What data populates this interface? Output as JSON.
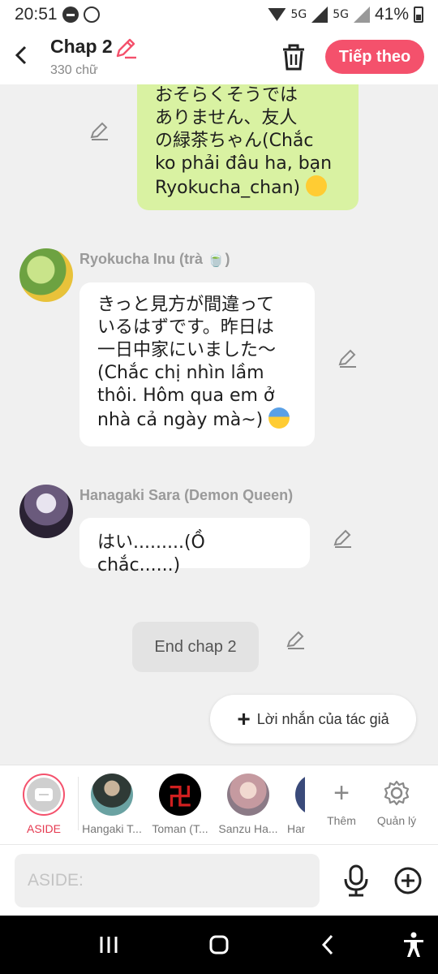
{
  "status_bar": {
    "time": "20:51",
    "network1": "5G",
    "network2": "5G",
    "battery": "41%"
  },
  "header": {
    "title": "Chap 2",
    "subtitle": "330 chữ",
    "next_label": "Tiếp theo"
  },
  "messages": [
    {
      "type": "self",
      "text": "おそらくそうではありません、友人の緑茶ちゃん(Chắc ko phải đâu ha, bạn Ryokucha_chan)",
      "emoji": "face-icon"
    },
    {
      "type": "other",
      "author": "Ryokucha Inu (trà 🍵)",
      "text": "きっと見方が間違っているはずです。昨日は一日中家にいました〜(Chắc chị nhìn lầm thôi. Hôm qua em ở nhà cả ngày mà~)",
      "emoji": "anxious-face-icon"
    },
    {
      "type": "other",
      "author": "Hanagaki Sara (Demon Queen)",
      "text": "はい.........(Ồ chắc......)"
    },
    {
      "type": "system",
      "text": "End chap 2"
    }
  ],
  "self_lines": [
    "おそらくそうでは",
    "ありません、友人",
    "の緑茶ちゃん(Chắc",
    "ko phải đâu ha, bạn",
    "Ryokucha_chan)"
  ],
  "ryokucha_lines": [
    "きっと見方が間違って",
    "いるはずです。昨日は",
    "一日中家にいました〜",
    "(Chắc chị nhìn lầm",
    "thôi. Hôm qua em ở",
    "nhà cả ngày mà~)"
  ],
  "author_note_label": "Lời nhắn của tác giả",
  "characters": [
    {
      "label": "ASIDE",
      "color": "#e53950"
    },
    {
      "label": "Hangaki T..."
    },
    {
      "label": "Toman (T..."
    },
    {
      "label": "Sanzu Ha..."
    },
    {
      "label": "Han"
    }
  ],
  "tools": {
    "add_label": "Thêm",
    "manage_label": "Quản lý"
  },
  "input": {
    "placeholder": "ASIDE:"
  },
  "colors": {
    "accent": "#f4516c",
    "self_bubble": "#d9f2a2"
  }
}
